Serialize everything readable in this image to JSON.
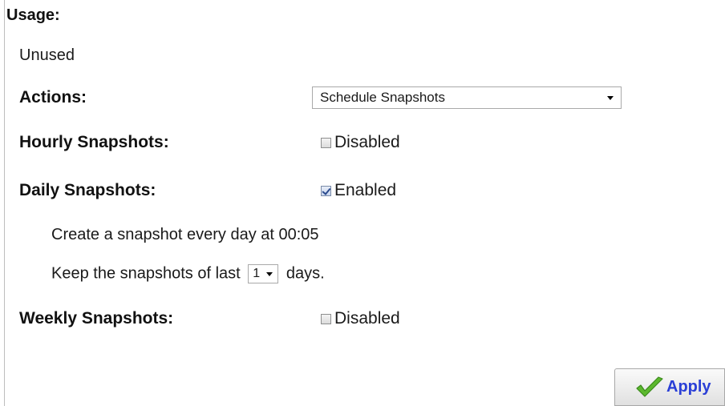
{
  "usage": {
    "heading": "Usage:",
    "value": "Unused"
  },
  "actions": {
    "label": "Actions:",
    "selected": "Schedule Snapshots"
  },
  "hourly": {
    "label": "Hourly Snapshots:",
    "checked": false,
    "status": "Disabled"
  },
  "daily": {
    "label": "Daily Snapshots:",
    "checked": true,
    "status": "Enabled",
    "schedule_text": "Create a snapshot every day at 00:05",
    "keep_prefix": "Keep the snapshots of last",
    "keep_value": "1",
    "keep_suffix": "days."
  },
  "weekly": {
    "label": "Weekly Snapshots:",
    "checked": false,
    "status": "Disabled"
  },
  "apply": {
    "label": "Apply",
    "icon": "green-checkmark-icon"
  },
  "colors": {
    "apply_text": "#2a3fd6",
    "check_green": "#5cb82e"
  }
}
